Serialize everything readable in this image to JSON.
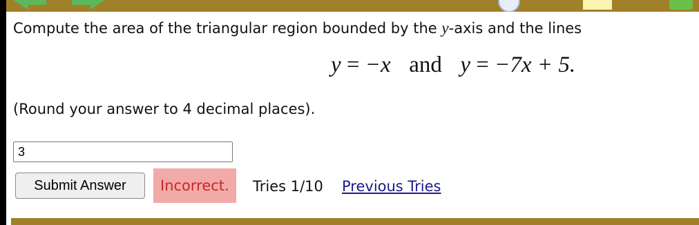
{
  "question": {
    "prefix": "Compute the area of the triangular region bounded by the",
    "var_y": "y",
    "suffix": "-axis and the lines"
  },
  "equation": {
    "lhs1": "y",
    "rel1": "=",
    "rhs1": "−x",
    "joiner": "and",
    "lhs2": "y",
    "rel2": "=",
    "rhs2": "−7x + 5."
  },
  "instruction": "(Round your answer to 4 decimal places).",
  "answer": {
    "value": "3"
  },
  "submit": {
    "label": "Submit Answer"
  },
  "feedback": {
    "status": "Incorrect.",
    "tries": "Tries 1/10",
    "previous_tries_link": "Previous Tries"
  },
  "colors": {
    "frame_bar": "#a08028",
    "incorrect_bg": "#f2aaa8",
    "incorrect_text": "#c62828"
  },
  "icons": [
    "back-arrow-icon",
    "forward-arrow-icon",
    "help-icon",
    "notes-icon",
    "grade-icon"
  ]
}
